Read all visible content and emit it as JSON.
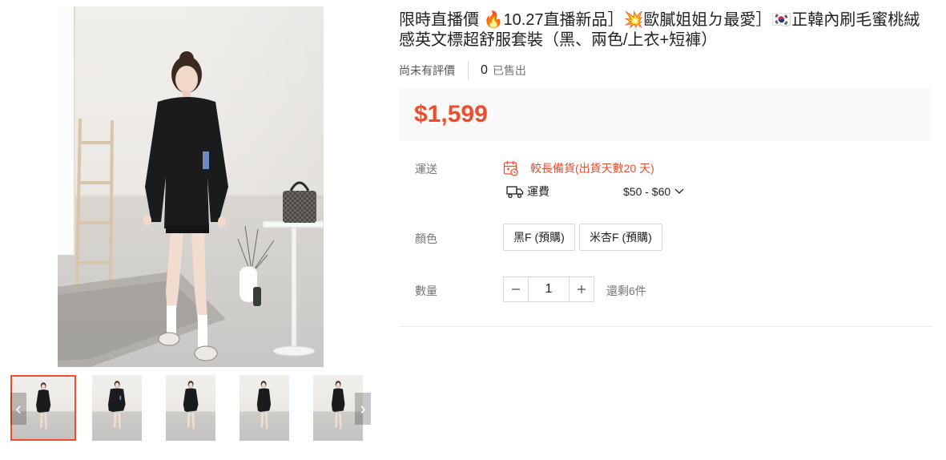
{
  "product": {
    "title": "限時直播價 🔥10.27直播新品］💥歐膩姐姐ㄉ最愛］🇰🇷正韓內刷毛蜜桃絨感英文標超舒服套裝（黑、兩色/上衣+短褲）",
    "rating_text": "尚未有評價",
    "sold_count": "0",
    "sold_label": "已售出",
    "price": "$1,599"
  },
  "shipping": {
    "label": "運送",
    "notice": "較長備貨(出貨天數20 天)",
    "fee_label": "運費",
    "fee_value": "$50 - $60"
  },
  "color": {
    "label": "顏色",
    "options": [
      "黑F (預購)",
      "米杏F (預購)"
    ]
  },
  "quantity": {
    "label": "數量",
    "value": "1",
    "stock_text": "還剩6件"
  },
  "gallery": {
    "thumbnail_count": 5,
    "prev_icon": "chevron-left-icon",
    "next_icon": "chevron-right-icon"
  },
  "colors": {
    "accent": "#ee4d2d",
    "price_bg": "#fafafa",
    "muted": "#757575"
  }
}
